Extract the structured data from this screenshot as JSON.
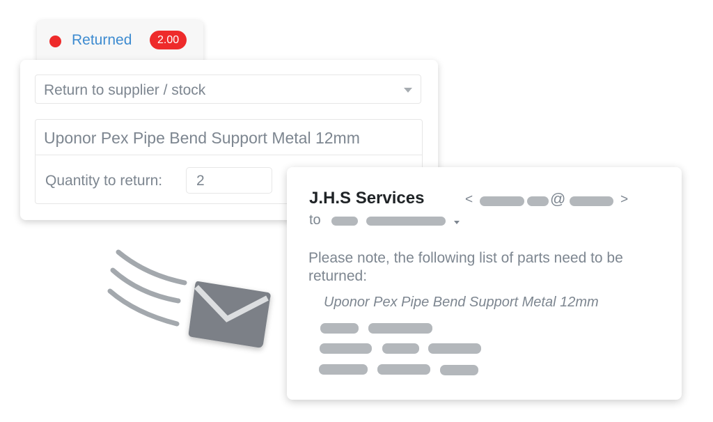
{
  "status_tab": {
    "status_color": "#ee2b2b",
    "label": "Returned",
    "badge": "2.00",
    "label_color": "#3d8bd0"
  },
  "return_form": {
    "return_type": {
      "selected": "Return to supplier / stock"
    },
    "product": {
      "name": "Uponor Pex Pipe Bend Support Metal 12mm",
      "quantity_label": "Quantity to return:",
      "quantity_value": "2"
    }
  },
  "illustration": {
    "icon": "flying-envelope-icon"
  },
  "email_preview": {
    "sender_name": "J.H.S Services",
    "email_open": "<",
    "email_at": "@",
    "email_close": ">",
    "to_label": "to",
    "message": "Please note, the following list of parts need to be returned:",
    "parts": [
      "Uponor Pex Pipe Bend Support Metal 12mm"
    ]
  }
}
